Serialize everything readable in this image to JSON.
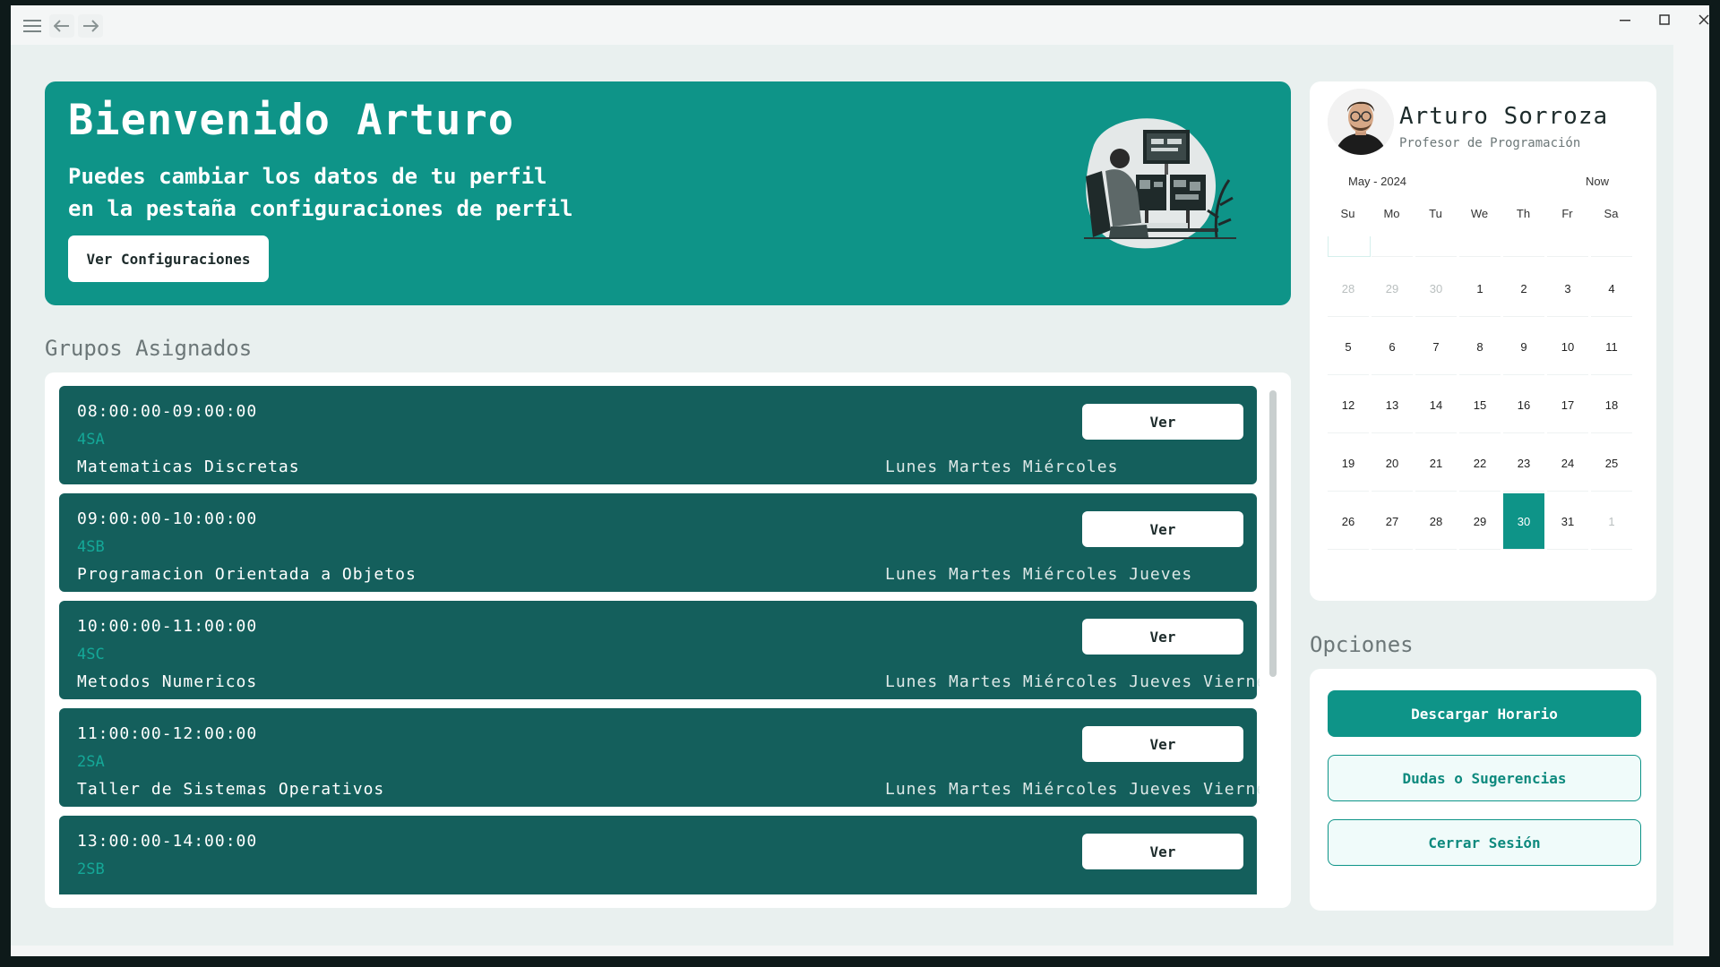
{
  "window": {
    "menu_icon": "hamburger-icon",
    "back_icon": "arrow-left-icon",
    "forward_icon": "arrow-right-icon"
  },
  "banner": {
    "title": "Bienvenido Arturo",
    "subtitle_line1": "Puedes cambiar los datos de tu perfil",
    "subtitle_line2": "en la pestaña configuraciones de perfil",
    "button_label": "Ver Configuraciones"
  },
  "groups": {
    "section_title": "Grupos Asignados",
    "items": [
      {
        "time": "08:00:00-09:00:00",
        "code": "4SA",
        "subject": "Matematicas Discretas",
        "days": "Lunes Martes Miércoles",
        "button": "Ver"
      },
      {
        "time": "09:00:00-10:00:00",
        "code": "4SB",
        "subject": "Programacion Orientada a Objetos",
        "days": "Lunes Martes Miércoles Jueves",
        "button": "Ver"
      },
      {
        "time": "10:00:00-11:00:00",
        "code": "4SC",
        "subject": "Metodos Numericos",
        "days": "Lunes Martes Miércoles Jueves Viernes",
        "button": "Ver"
      },
      {
        "time": "11:00:00-12:00:00",
        "code": "2SA",
        "subject": "Taller de Sistemas Operativos",
        "days": "Lunes Martes Miércoles Jueves Viernes",
        "button": "Ver"
      },
      {
        "time": "13:00:00-14:00:00",
        "code": "2SB",
        "subject": "",
        "days": "",
        "button": "Ver"
      }
    ]
  },
  "profile": {
    "name": "Arturo Sorroza",
    "role": "Profesor de Programación"
  },
  "calendar": {
    "month_label": "May - 2024",
    "now_label": "Now",
    "weekdays": [
      "Su",
      "Mo",
      "Tu",
      "We",
      "Th",
      "Fr",
      "Sa"
    ],
    "weeks": [
      [
        "28",
        "29",
        "30",
        "1",
        "2",
        "3",
        "4"
      ],
      [
        "5",
        "6",
        "7",
        "8",
        "9",
        "10",
        "11"
      ],
      [
        "12",
        "13",
        "14",
        "15",
        "16",
        "17",
        "18"
      ],
      [
        "19",
        "20",
        "21",
        "22",
        "23",
        "24",
        "25"
      ],
      [
        "26",
        "27",
        "28",
        "29",
        "30",
        "31",
        "1"
      ]
    ],
    "selected_day": "30"
  },
  "options": {
    "section_title": "Opciones",
    "download_label": "Descargar Horario",
    "feedback_label": "Dudas o Sugerencias",
    "logout_label": "Cerrar Sesión"
  },
  "colors": {
    "accent": "#0e9488",
    "card_dark": "#145f5c",
    "background": "#e9f0ef"
  }
}
